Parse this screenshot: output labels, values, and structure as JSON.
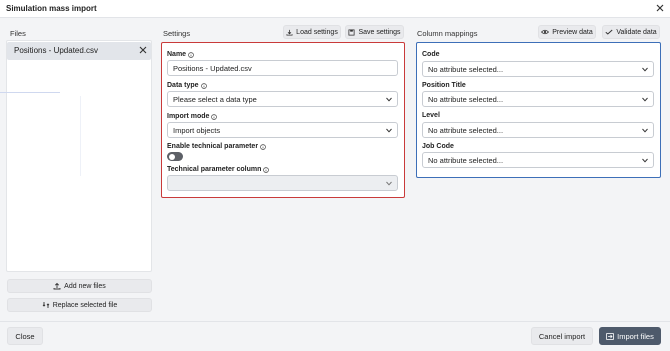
{
  "window": {
    "title": "Simulation mass import"
  },
  "files": {
    "heading": "Files",
    "items": [
      {
        "name": "Positions - Updated.csv",
        "selected": true
      }
    ],
    "add_label": "Add new files",
    "replace_label": "Replace selected file"
  },
  "settings": {
    "heading": "Settings",
    "load_label": "Load settings",
    "save_label": "Save settings",
    "name_label": "Name",
    "name_value": "Positions - Updated.csv",
    "data_type_label": "Data type",
    "data_type_value": "Please select a data type",
    "import_mode_label": "Import mode",
    "import_mode_value": "Import objects",
    "technical_param_label": "Enable technical parameter",
    "technical_param_enabled": false,
    "technical_col_label": "Technical parameter column",
    "technical_col_value": ""
  },
  "mappings": {
    "heading": "Column mappings",
    "preview_label": "Preview data",
    "validate_label": "Validate data",
    "columns": [
      {
        "label": "Code",
        "value": "No attribute selected..."
      },
      {
        "label": "Position Title",
        "value": "No attribute selected..."
      },
      {
        "label": "Level",
        "value": "No attribute selected..."
      },
      {
        "label": "Job Code",
        "value": "No attribute selected..."
      }
    ]
  },
  "footer": {
    "close_label": "Close",
    "cancel_label": "Cancel import",
    "import_label": "Import files"
  },
  "colors": {
    "settings_border": "#c93a3a",
    "mapping_border": "#3d6fb8",
    "primary_button": "#4e5a6b"
  },
  "icons": {
    "close": "close-icon",
    "info": "info-icon",
    "chevron": "chevron-down-icon",
    "download": "download-icon",
    "save": "save-icon",
    "eye": "eye-icon",
    "check": "check-icon",
    "upload": "upload-icon",
    "replace": "replace-icon",
    "import": "import-icon"
  }
}
